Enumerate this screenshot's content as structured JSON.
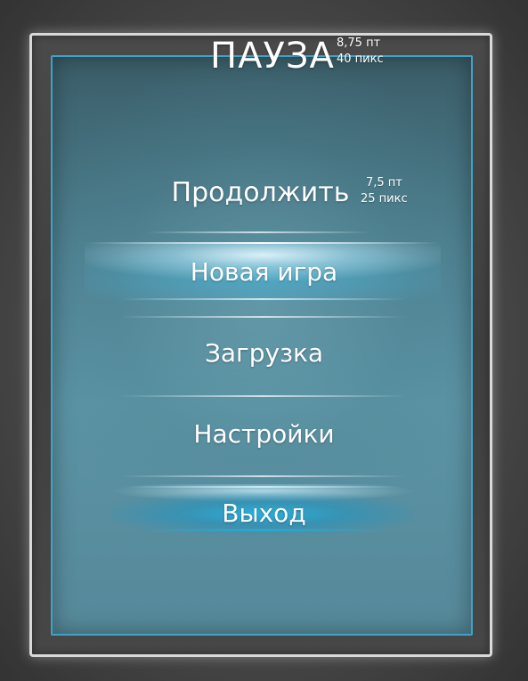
{
  "pause_menu": {
    "title": "ПАУЗА",
    "title_spec": {
      "size_pt": "8,75 пт",
      "size_px": "40 пикс"
    },
    "item_spec": {
      "size_pt": "7,5 пт",
      "size_px": "25 пикс"
    },
    "items": [
      {
        "label": "Продолжить",
        "state": "normal"
      },
      {
        "label": "Новая игра",
        "state": "hover"
      },
      {
        "label": "Загрузка",
        "state": "normal"
      },
      {
        "label": "Настройки",
        "state": "normal"
      },
      {
        "label": "Выход",
        "state": "pressed"
      }
    ]
  },
  "colors": {
    "panel_border": "#3fa3c7",
    "panel_bg": "#5b93a4",
    "highlight": "#46afd2",
    "text": "#ffffff"
  }
}
